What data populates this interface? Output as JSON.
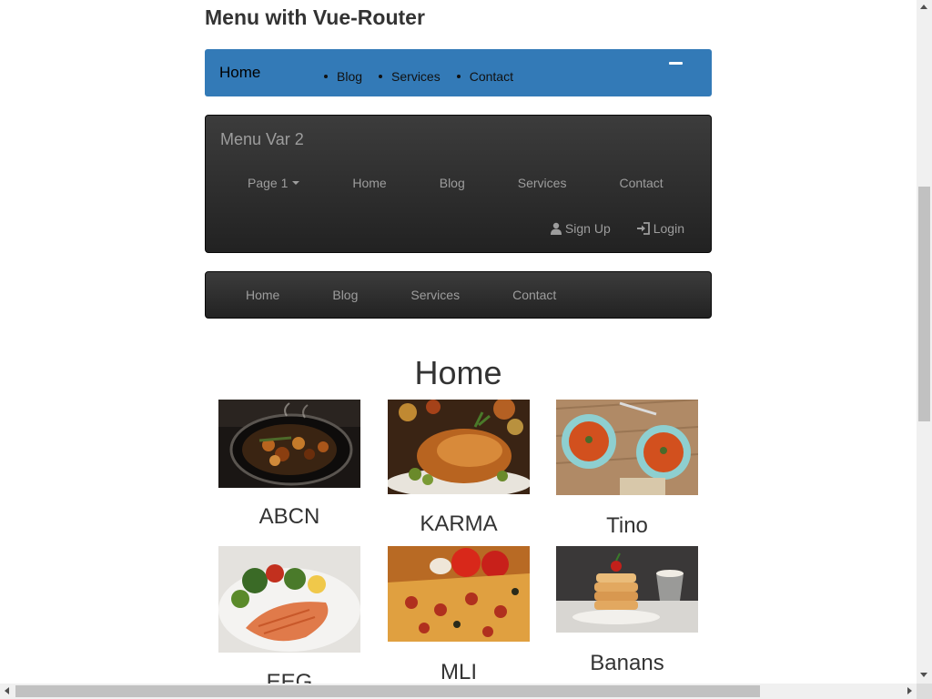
{
  "page": {
    "title": "Menu with Vue-Router"
  },
  "menu1": {
    "brand": "Home",
    "items": [
      "Blog",
      "Services",
      "Contact"
    ],
    "bg_color": "#337ab7"
  },
  "menu2": {
    "brand": "Menu Var 2",
    "items": [
      {
        "label": "Page 1",
        "dropdown": true
      },
      {
        "label": "Home"
      },
      {
        "label": "Blog"
      },
      {
        "label": "Services"
      },
      {
        "label": "Contact"
      }
    ],
    "right": [
      {
        "label": "Sign Up",
        "icon": "user-icon"
      },
      {
        "label": "Login",
        "icon": "login-icon"
      }
    ]
  },
  "menu3": {
    "items": [
      "Home",
      "Blog",
      "Services",
      "Contact"
    ]
  },
  "home": {
    "title": "Home",
    "cards": [
      {
        "name": "ABCN",
        "image": "skillet-food-photo"
      },
      {
        "name": "KARMA",
        "image": "roast-chicken-photo"
      },
      {
        "name": "Tino",
        "image": "tomato-soup-photo"
      },
      {
        "name": "EEG",
        "image": "salmon-salad-photo"
      },
      {
        "name": "MLI",
        "image": "pizza-photo"
      },
      {
        "name": "Banans",
        "image": "pancakes-photo"
      }
    ]
  }
}
